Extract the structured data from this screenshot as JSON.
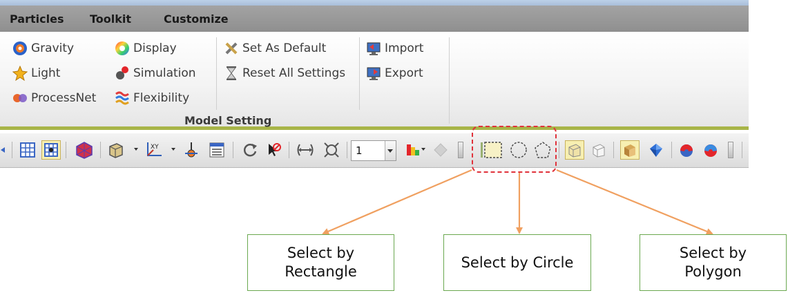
{
  "menu": {
    "items": [
      "Particles",
      "Toolkit",
      "Customize"
    ]
  },
  "ribbon": {
    "group_label": "Model Setting",
    "col1": [
      {
        "label": "Gravity",
        "icon": "gravity-icon"
      },
      {
        "label": "Light",
        "icon": "light-icon"
      },
      {
        "label": "ProcessNet",
        "icon": "processnet-icon"
      }
    ],
    "col2": [
      {
        "label": "Display",
        "icon": "display-icon"
      },
      {
        "label": "Simulation",
        "icon": "simulation-icon"
      },
      {
        "label": "Flexibility",
        "icon": "flexibility-icon"
      }
    ],
    "col3": [
      {
        "label": "Set As Default",
        "icon": "tools-icon"
      },
      {
        "label": "Reset All Settings",
        "icon": "hourglass-icon"
      }
    ],
    "col4": [
      {
        "label": "Import",
        "icon": "import-icon"
      },
      {
        "label": "Export",
        "icon": "export-icon"
      }
    ]
  },
  "toolbar": {
    "combo_value": "1"
  },
  "callouts": {
    "rectangle": "Select by\nRectangle",
    "circle": "Select by Circle",
    "polygon": "Select by\nPolygon"
  },
  "colors": {
    "highlight": "#e0313a",
    "arrow": "#f0a060",
    "callout_border": "#6aa84f",
    "ribbon_accent": "#a8b548"
  }
}
